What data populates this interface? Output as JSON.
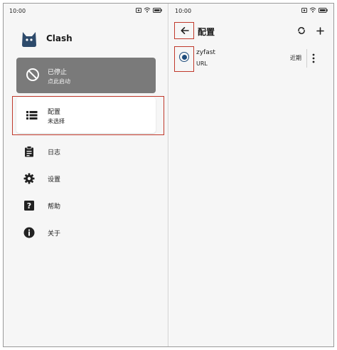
{
  "left": {
    "status_bar": {
      "time": "10:00"
    },
    "app": {
      "name": "Clash"
    },
    "status_card": {
      "title": "已停止",
      "subtitle": "点此启动"
    },
    "profile_card": {
      "title": "配置",
      "subtitle": "未选择"
    },
    "menu": [
      {
        "label": "日志",
        "icon": "clipboard-icon"
      },
      {
        "label": "设置",
        "icon": "gear-icon"
      },
      {
        "label": "帮助",
        "icon": "help-icon"
      },
      {
        "label": "关于",
        "icon": "info-icon"
      }
    ]
  },
  "right": {
    "status_bar": {
      "time": "10:00"
    },
    "header": {
      "title": "配置"
    },
    "profiles": [
      {
        "name": "zyfast",
        "type": "URL",
        "updated": "近期",
        "selected": true
      }
    ]
  },
  "colors": {
    "background": "#f6f6f6",
    "status_card": "#7a7a7a",
    "radio": "#1e4c7c",
    "highlight": "#c0392b"
  }
}
